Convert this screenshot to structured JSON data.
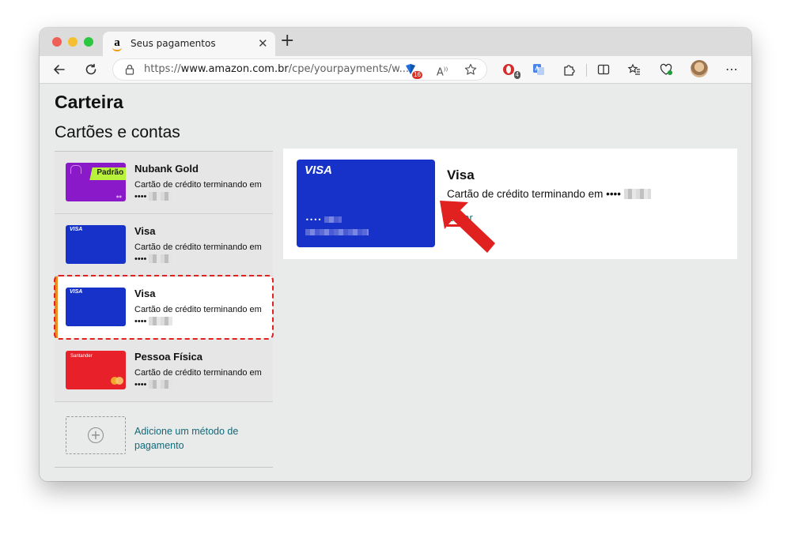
{
  "browser": {
    "tab_title": "Seus pagamentos",
    "url_prefix": "https://",
    "url_domain": "www.amazon.com.br",
    "url_rest": "/cpe/yourpayments/w...",
    "ext_badge_1": "16",
    "ext_badge_2": "4"
  },
  "page": {
    "title": "Carteira",
    "subtitle": "Cartões e contas"
  },
  "cards": [
    {
      "name": "Nubank Gold",
      "desc": "Cartão de crédito terminando em ••••",
      "thumb_label": "Padrão",
      "color": "#8a19c9"
    },
    {
      "name": "Visa",
      "desc": "Cartão de crédito terminando em ••••",
      "thumb_label": "VISA",
      "color": "#1732c9"
    },
    {
      "name": "Visa",
      "desc": "Cartão de crédito terminando em ••••",
      "thumb_label": "VISA",
      "color": "#1732c9"
    },
    {
      "name": "Pessoa Física",
      "desc": "Cartão de crédito terminando em ••••",
      "thumb_label": "Santander",
      "color": "#e8202a"
    }
  ],
  "add_method": {
    "label": "Adicione um método de pagamento"
  },
  "detail": {
    "card_brand": "VISA",
    "card_dots": "••••",
    "title": "Visa",
    "desc": "Cartão de crédito terminando em ••••",
    "edit_label": "Editar"
  },
  "colors": {
    "accent": "#f08c1e",
    "highlight": "#e0211f",
    "link": "#0f6a7a"
  }
}
